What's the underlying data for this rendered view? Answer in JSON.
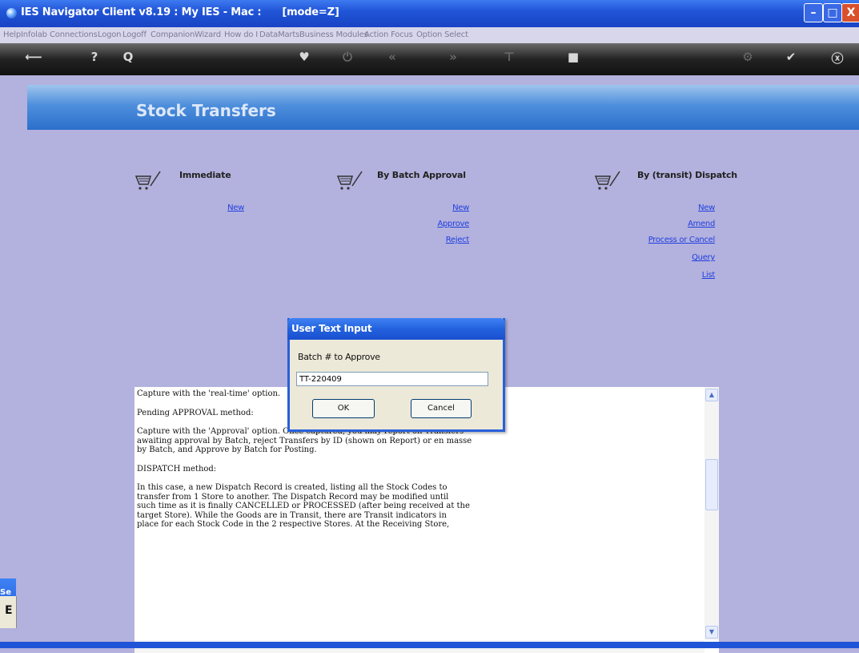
{
  "window": {
    "title": "IES Navigator Client v8.19 : My IES - Mac :      [mode=Z]",
    "controls": {
      "minimize": "–",
      "maximize": "□",
      "close": "X"
    }
  },
  "menu": [
    "Help",
    "Infolab",
    "Connections",
    "Logon",
    "Logoff",
    "Companion",
    "Wizard",
    "How do I",
    "DataMarts",
    "Business Modules",
    "Action Focus",
    "Option Select"
  ],
  "toolbar": [
    {
      "icon": "back-arrow-icon",
      "glyph": "⟵",
      "enabled": true
    },
    {
      "icon": "help-icon",
      "glyph": "?",
      "enabled": true
    },
    {
      "icon": "search-icon",
      "glyph": "Q",
      "enabled": true
    },
    {
      "icon": "heart-icon",
      "glyph": "♥",
      "enabled": true
    },
    {
      "icon": "power-icon",
      "glyph": "⏻",
      "enabled": false
    },
    {
      "icon": "rewind-icon",
      "glyph": "«",
      "enabled": false
    },
    {
      "icon": "forward-icon",
      "glyph": "»",
      "enabled": false
    },
    {
      "icon": "tree-icon",
      "glyph": "⊤",
      "enabled": false
    },
    {
      "icon": "stop-icon",
      "glyph": "■",
      "enabled": true
    },
    {
      "icon": "settings-icon",
      "glyph": "⚙",
      "enabled": false
    },
    {
      "icon": "check-icon",
      "glyph": "✔",
      "enabled": true
    },
    {
      "icon": "close-circle-icon",
      "glyph": "ⓧ",
      "enabled": true
    }
  ],
  "page": {
    "title": "Stock Transfers"
  },
  "sections": {
    "immediate": {
      "heading": "Immediate",
      "links": [
        "New"
      ]
    },
    "batch": {
      "heading": "By Batch Approval",
      "links": [
        "New",
        "Approve",
        "Reject"
      ]
    },
    "dispatch": {
      "heading": "By (transit) Dispatch",
      "links": [
        "New",
        "Amend",
        "Process or Cancel",
        "Query",
        "List"
      ]
    }
  },
  "dialog": {
    "title": "User Text Input",
    "prompt": "Batch # to Approve",
    "value": "TT-220409",
    "ok_label": "OK",
    "cancel_label": "Cancel"
  },
  "help_text": [
    "Capture with the 'real-time' option.",
    "Pending APPROVAL method:",
    "Capture with the 'Approval' option. Once captured, you may report on Transfers\nawaiting approval by Batch, reject Transfers by ID (shown on Report) or en masse\nby Batch, and Approve by Batch for Posting.",
    "DISPATCH method:",
    "In this case, a new Dispatch Record is created, listing all the Stock Codes to\ntransfer from 1 Store to another. The Dispatch Record may be modified until\nsuch time as it is finally CANCELLED or PROCESSED (after being received at the\ntarget Store). While the Goods are in Transit, there are Transit indicators in\nplace for each Stock Code in the 2 respective Stores. At the Receiving Store,"
  ],
  "side_tab": {
    "label": "Se",
    "char": "E"
  }
}
